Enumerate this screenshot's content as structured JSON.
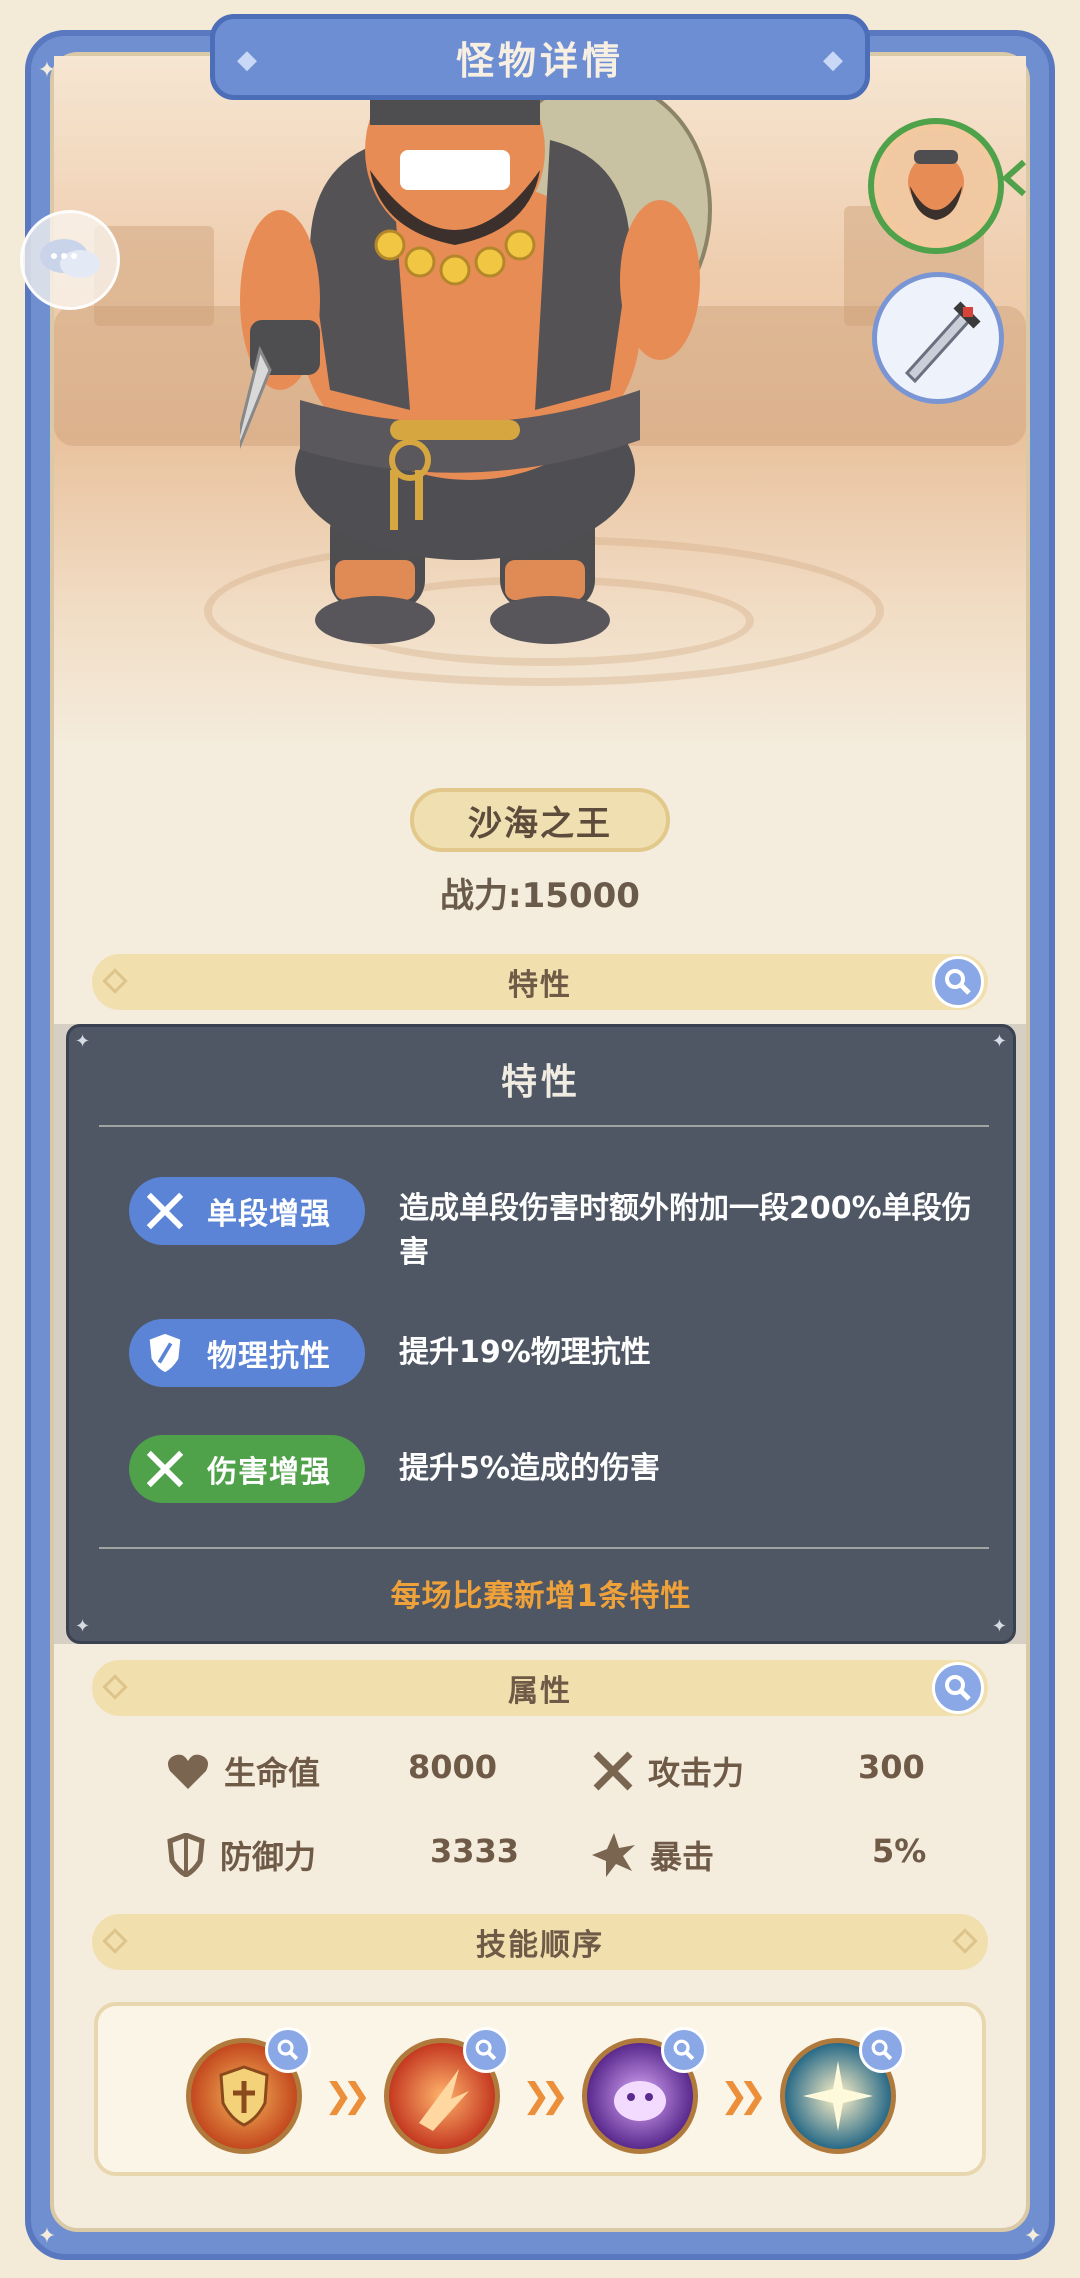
{
  "header": {
    "title": "怪物详情"
  },
  "monster": {
    "name": "沙海之王",
    "power_label": "战力:15000"
  },
  "sections": {
    "traits": "特性",
    "attributes": "属性",
    "skill_order": "技能顺序"
  },
  "attributes": [
    {
      "icon": "heart-icon",
      "label": "生命值",
      "value": "8000"
    },
    {
      "icon": "crossed-swords-icon",
      "label": "攻击力",
      "value": "300"
    },
    {
      "icon": "shield-icon",
      "label": "防御力",
      "value": "3333"
    },
    {
      "icon": "star-burst-icon",
      "label": "暴击",
      "value": "5%"
    }
  ],
  "popup": {
    "title": "特性",
    "traits": [
      {
        "name": "单段增强",
        "icon": "crossed-swords-icon",
        "color": "#5b84d6",
        "desc": "造成单段伤害时额外附加一段200%单段伤害"
      },
      {
        "name": "物理抗性",
        "icon": "shield-sword-icon",
        "color": "#5b84d6",
        "desc": "提升19%物理抗性"
      },
      {
        "name": "伤害增强",
        "icon": "crossed-swords-icon",
        "color": "#4fa14a",
        "desc": "提升5%造成的伤害"
      }
    ],
    "footer": "每场比赛新增1条特性"
  },
  "skills": [
    {
      "icon": "holy-shield-skill-icon"
    },
    {
      "icon": "fire-slash-skill-icon"
    },
    {
      "icon": "purple-orb-skill-icon"
    },
    {
      "icon": "light-burst-skill-icon"
    }
  ],
  "colors": {
    "frame": "#6f8fd1",
    "panel": "#f4ecdc",
    "section_bar": "#f1dfae",
    "popup_bg": "#485060",
    "accent_orange": "#f0a23a"
  }
}
